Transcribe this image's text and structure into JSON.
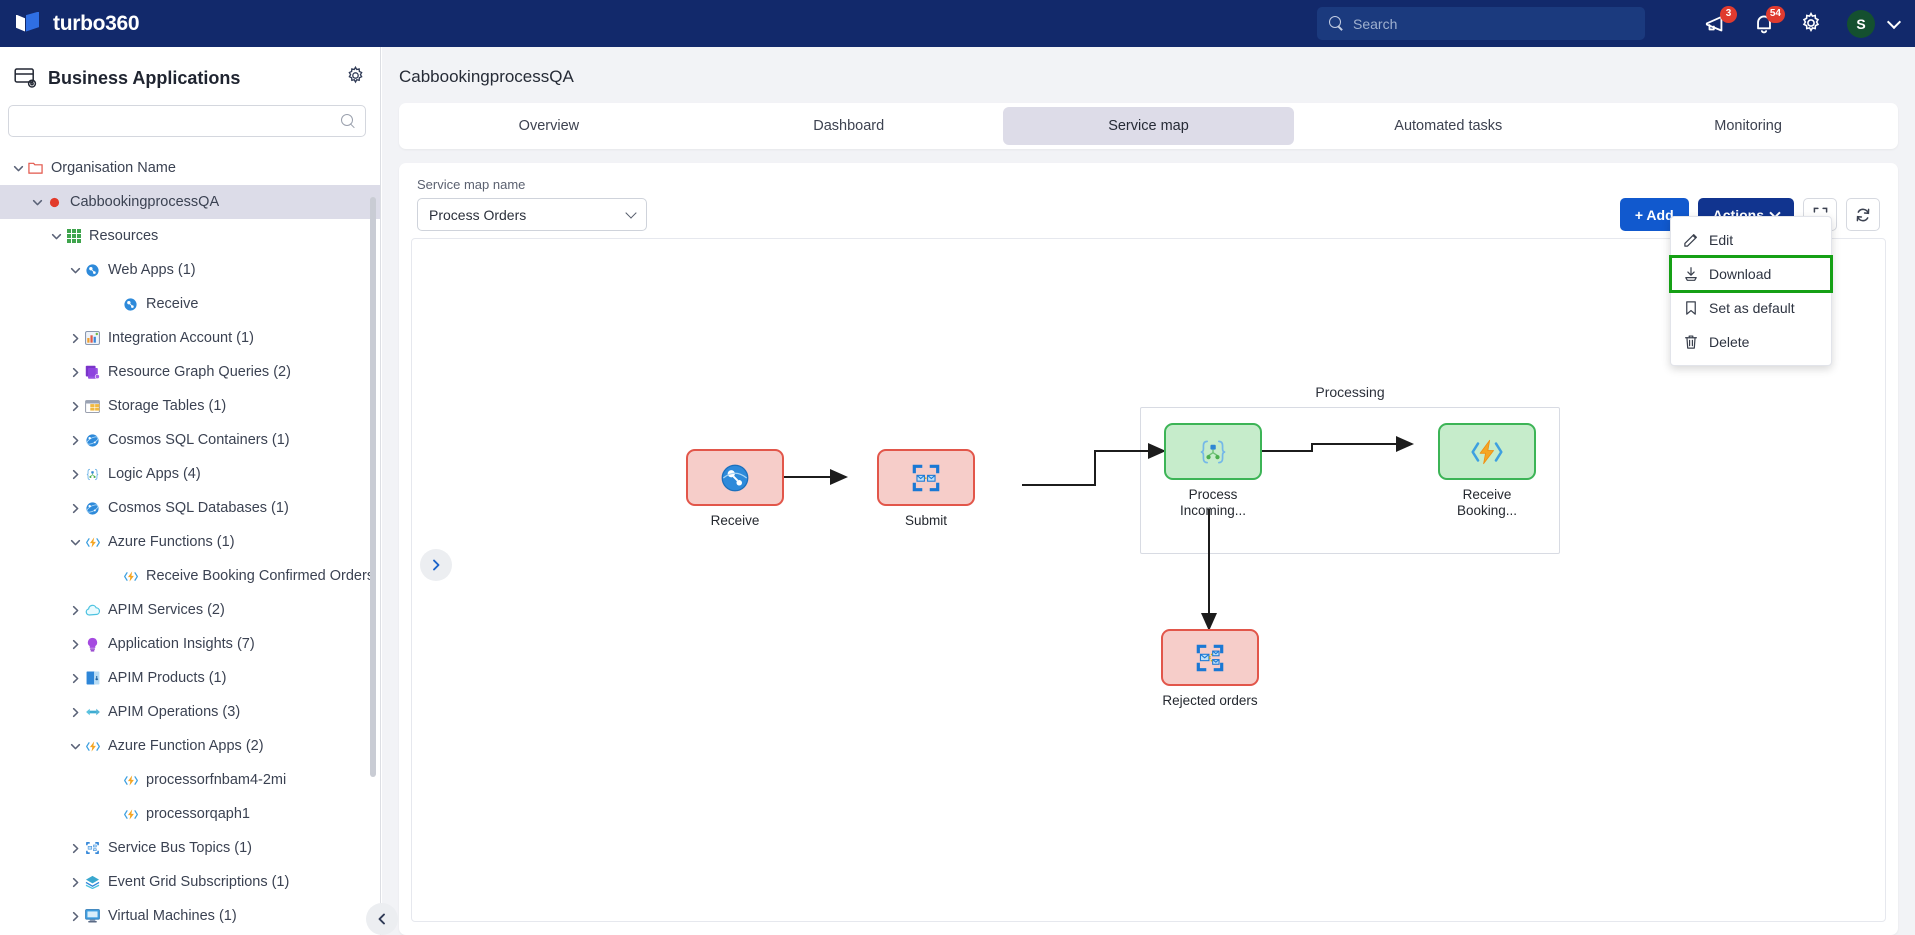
{
  "topbar": {
    "brand": "turbo360",
    "search_placeholder": "Search",
    "search_value": "",
    "announcement_badge": "3",
    "notification_badge": "54",
    "avatar_initial": "S"
  },
  "sidebar": {
    "title": "Business Applications",
    "search_placeholder": "",
    "search_value": "",
    "tree": [
      {
        "label": "Organisation Name",
        "depth": 0,
        "twist": "down",
        "icon": "folder-icon",
        "selected": false
      },
      {
        "label": "CabbookingprocessQA",
        "depth": 1,
        "twist": "down",
        "icon": "red-dot-icon",
        "selected": true
      },
      {
        "label": "Resources",
        "depth": 2,
        "twist": "down",
        "icon": "grid-green-icon",
        "selected": false
      },
      {
        "label": "Web Apps (1)",
        "depth": 3,
        "twist": "down",
        "icon": "web-app-icon",
        "selected": false
      },
      {
        "label": "Receive",
        "depth": 5,
        "twist": "none",
        "icon": "web-app-icon",
        "selected": false
      },
      {
        "label": "Integration Account (1)",
        "depth": 3,
        "twist": "right",
        "icon": "integration-account-icon",
        "selected": false
      },
      {
        "label": "Resource Graph Queries (2)",
        "depth": 3,
        "twist": "right",
        "icon": "resource-graph-icon",
        "selected": false
      },
      {
        "label": "Storage Tables (1)",
        "depth": 3,
        "twist": "right",
        "icon": "storage-table-icon",
        "selected": false
      },
      {
        "label": "Cosmos SQL Containers (1)",
        "depth": 3,
        "twist": "right",
        "icon": "cosmos-icon",
        "selected": false
      },
      {
        "label": "Logic Apps (4)",
        "depth": 3,
        "twist": "right",
        "icon": "logic-app-icon",
        "selected": false
      },
      {
        "label": "Cosmos SQL Databases (1)",
        "depth": 3,
        "twist": "right",
        "icon": "cosmos-icon",
        "selected": false
      },
      {
        "label": "Azure Functions (1)",
        "depth": 3,
        "twist": "down",
        "icon": "azure-function-icon",
        "selected": false
      },
      {
        "label": "Receive Booking Confirmed Orders",
        "depth": 5,
        "twist": "none",
        "icon": "azure-function-icon",
        "selected": false
      },
      {
        "label": "APIM Services (2)",
        "depth": 3,
        "twist": "right",
        "icon": "apim-service-icon",
        "selected": false
      },
      {
        "label": "Application Insights (7)",
        "depth": 3,
        "twist": "right",
        "icon": "app-insights-icon",
        "selected": false
      },
      {
        "label": "APIM Products (1)",
        "depth": 3,
        "twist": "right",
        "icon": "apim-product-icon",
        "selected": false
      },
      {
        "label": "APIM Operations (3)",
        "depth": 3,
        "twist": "right",
        "icon": "apim-operation-icon",
        "selected": false
      },
      {
        "label": "Azure Function Apps (2)",
        "depth": 3,
        "twist": "down",
        "icon": "azure-function-icon",
        "selected": false
      },
      {
        "label": "processorfnbam4-2mi",
        "depth": 5,
        "twist": "none",
        "icon": "azure-function-icon",
        "selected": false
      },
      {
        "label": "processorqaph1",
        "depth": 5,
        "twist": "none",
        "icon": "azure-function-icon",
        "selected": false
      },
      {
        "label": "Service Bus Topics (1)",
        "depth": 3,
        "twist": "right",
        "icon": "service-bus-topic-icon",
        "selected": false
      },
      {
        "label": "Event Grid Subscriptions (1)",
        "depth": 3,
        "twist": "right",
        "icon": "event-grid-icon",
        "selected": false
      },
      {
        "label": "Virtual Machines (1)",
        "depth": 3,
        "twist": "right",
        "icon": "virtual-machine-icon",
        "selected": false
      }
    ]
  },
  "main": {
    "page_title": "CabbookingprocessQA",
    "tabs": [
      {
        "label": "Overview",
        "active": false
      },
      {
        "label": "Dashboard",
        "active": false
      },
      {
        "label": "Service map",
        "active": true
      },
      {
        "label": "Automated tasks",
        "active": false
      },
      {
        "label": "Monitoring",
        "active": false
      }
    ],
    "service_map": {
      "field_label": "Service map name",
      "selected_map": "Process Orders",
      "add_label": "+ Add",
      "actions_label": "Actions",
      "menu": [
        {
          "label": "Edit",
          "icon": "edit-icon",
          "highlighted": false
        },
        {
          "label": "Download",
          "icon": "download-icon",
          "highlighted": true
        },
        {
          "label": "Set as default",
          "icon": "bookmark-icon",
          "highlighted": false
        },
        {
          "label": "Delete",
          "icon": "trash-icon",
          "highlighted": false
        }
      ]
    }
  },
  "diagram": {
    "group_label": "Processing",
    "nodes": [
      {
        "id": "receive",
        "label": "Receive",
        "status": "red",
        "icon": "web-app-icon"
      },
      {
        "id": "submit",
        "label": "Submit",
        "status": "red",
        "icon": "service-bus-queue-icon"
      },
      {
        "id": "process",
        "label": "Process Incoming...",
        "status": "green",
        "icon": "logic-app-icon"
      },
      {
        "id": "booking",
        "label": "Receive Booking...",
        "status": "green",
        "icon": "azure-function-icon"
      },
      {
        "id": "rejected",
        "label": "Rejected orders",
        "status": "red",
        "icon": "service-bus-topic-icon"
      }
    ]
  },
  "colors": {
    "brand_navy": "#12296b",
    "accent_blue": "#1159ce",
    "actions_blue": "#11348f",
    "node_red_border": "#e2564a",
    "node_red_fill": "#f6cdc9",
    "node_green_border": "#3cb456",
    "node_green_fill": "#c6eccb",
    "highlight_green": "#15a015",
    "badge_red": "#e03b2f"
  }
}
